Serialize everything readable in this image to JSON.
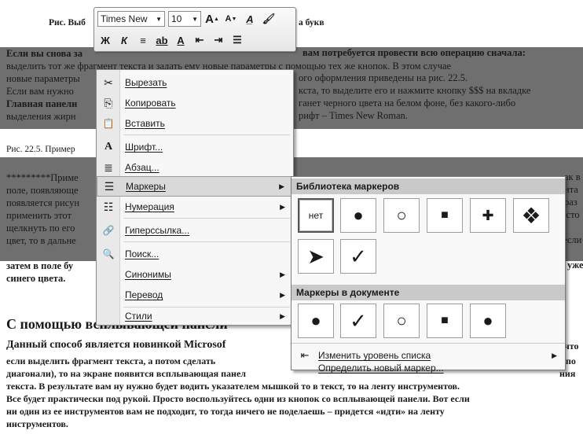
{
  "document": {
    "figure_caption_top": "Рис. Выб",
    "figure_caption_top_tail": "а букв",
    "lines": [
      "Если вы снова за",
      "выделить тот же фрагмент текста и задать ему новые параметры с помощью тех же кнопок. В этом случае",
      "новые параметры",
      "Если вам нужно",
      "Главная панели",
      "выделения жирн",
      "",
      "Рис. 22.5. Пример",
      "",
      "*********Приме",
      "поле, появляюще",
      "появляется рисун",
      "применить этот",
      "щелкнуть по его",
      "цвет, то в дальне",
      "затем в поле бу",
      "синего цвета."
    ],
    "line_tails": [
      "вам потребуется провести всю операцию сначала:",
      "",
      "ого оформления приведены на рис. 22.5.",
      "кста, то выделите его и нажмите кнопку $$$ на вкладке",
      "ганет черного цвета на белом фоне, без какого-либо",
      "рифт – Times New Roman.",
      "",
      "",
      "",
      "ак в",
      "нта",
      "раз",
      "осто",
      "",
      "если",
      "уже",
      ""
    ],
    "heading": "С помощью всплывающей панели",
    "para_lines": [
      "Данный способ является новинкой Microsof",
      "если выделить фрагмент текста, а потом сделать",
      "диагонали), то на экране появится всплывающая панел",
      "текста. В результате вам ну нужно будет водить указателем мышкой то в текст, то на ленту инструментов.",
      "Все будет практически под рукой. Просто воспользуйтесь одни из кнопок со всплывающей панели. Вот если",
      "ни один из ее инструментов вам не подходит, то тогда ничего не поделаешь – придется «идти» на ленту",
      "инструментов."
    ],
    "para_tails": [
      "что",
      "(по",
      "ния"
    ]
  },
  "mini_toolbar": {
    "font_name": "Times New",
    "font_size": "10",
    "grow_font_label": "A",
    "shrink_font_label": "A",
    "bold_label": "Ж",
    "italic_label": "К",
    "font_color_label": "A"
  },
  "context_menu": {
    "items": [
      {
        "label": "Вырезать",
        "icon": "scissors-icon",
        "glyph": "✂"
      },
      {
        "label": "Копировать",
        "icon": "copy-icon",
        "glyph": "⎘"
      },
      {
        "label": "Вставить",
        "icon": "paste-icon",
        "glyph": "📋"
      },
      {
        "label": "Шрифт...",
        "icon": "font-icon",
        "glyph": "A"
      },
      {
        "label": "Абзац...",
        "icon": "paragraph-icon",
        "glyph": "≣"
      },
      {
        "label": "Маркеры",
        "icon": "bullets-icon",
        "glyph": "☰"
      },
      {
        "label": "Нумерация",
        "icon": "numbering-icon",
        "glyph": "☷"
      },
      {
        "label": "Гиперссылка...",
        "icon": "hyperlink-icon",
        "glyph": "🔗"
      },
      {
        "label": "Поиск...",
        "icon": "search-icon",
        "glyph": "🔍"
      },
      {
        "label": "Синонимы",
        "icon": "",
        "glyph": ""
      },
      {
        "label": "Перевод",
        "icon": "",
        "glyph": ""
      },
      {
        "label": "Стили",
        "icon": "",
        "glyph": ""
      }
    ]
  },
  "bullet_panel": {
    "library_title": "Библиотека маркеров",
    "library_cells": [
      "нет",
      "●",
      "○",
      "■",
      "✚",
      "❖",
      "➤",
      "✓"
    ],
    "document_title": "Маркеры в документе",
    "document_cells": [
      "●",
      "✓",
      "○",
      "■",
      "●"
    ],
    "change_level_label": "Изменить уровень списка",
    "define_new_label": "Определить новый маркер..."
  }
}
